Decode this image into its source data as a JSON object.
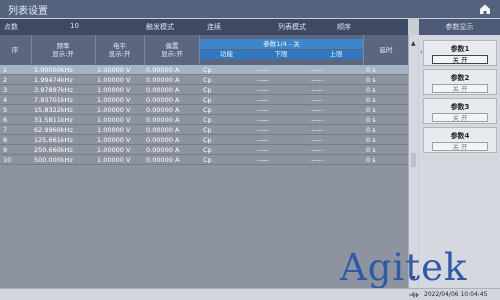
{
  "window": {
    "title": "列表设置"
  },
  "info_bar": {
    "points_label": "点数",
    "points_value": "10",
    "trigger_label": "触发模式",
    "trigger_value": "连续",
    "list_mode_label": "列表模式",
    "list_mode_value": "顺序"
  },
  "table": {
    "headers": {
      "index": "序",
      "freq_line1": "频率",
      "freq_line2": "显示:开",
      "level_line1": "电平",
      "level_line2": "显示:开",
      "bias_line1": "偏置",
      "bias_line2": "显示:开",
      "param_group": "参数1/4 - 关",
      "func": "功能",
      "lower": "下限",
      "upper": "上限",
      "delay": "延时"
    },
    "rows": [
      {
        "idx": "1",
        "freq": "1.00000kHz",
        "level": "1.00000 V",
        "bias": "0.00000 A",
        "func": "Cp",
        "lower": "-----",
        "upper": "-----",
        "delay": "0 s"
      },
      {
        "idx": "2",
        "freq": "1.99474kHz",
        "level": "1.00000 V",
        "bias": "0.00000 A",
        "func": "Cp",
        "lower": "-----",
        "upper": "-----",
        "delay": "0 s"
      },
      {
        "idx": "3",
        "freq": "3.97897kHz",
        "level": "1.00000 V",
        "bias": "0.00000 A",
        "func": "Cp",
        "lower": "-----",
        "upper": "-----",
        "delay": "0 s"
      },
      {
        "idx": "4",
        "freq": "7.93701kHz",
        "level": "1.00000 V",
        "bias": "0.00000 A",
        "func": "Cp",
        "lower": "-----",
        "upper": "-----",
        "delay": "0 s"
      },
      {
        "idx": "5",
        "freq": "15.8322kHz",
        "level": "1.00000 V",
        "bias": "0.00000 A",
        "func": "Cp",
        "lower": "-----",
        "upper": "-----",
        "delay": "0 s"
      },
      {
        "idx": "6",
        "freq": "31.5811kHz",
        "level": "1.00000 V",
        "bias": "0.00000 A",
        "func": "Cp",
        "lower": "-----",
        "upper": "-----",
        "delay": "0 s"
      },
      {
        "idx": "7",
        "freq": "62.9960kHz",
        "level": "1.00000 V",
        "bias": "0.00000 A",
        "func": "Cp",
        "lower": "-----",
        "upper": "-----",
        "delay": "0 s"
      },
      {
        "idx": "8",
        "freq": "125.661kHz",
        "level": "1.00000 V",
        "bias": "0.00000 A",
        "func": "Cp",
        "lower": "-----",
        "upper": "-----",
        "delay": "0 s"
      },
      {
        "idx": "9",
        "freq": "250.660kHz",
        "level": "1.00000 V",
        "bias": "0.00000 A",
        "func": "Cp",
        "lower": "-----",
        "upper": "-----",
        "delay": "0 s"
      },
      {
        "idx": "10",
        "freq": "500.000kHz",
        "level": "1.00000 V",
        "bias": "0.00000 A",
        "func": "Cp",
        "lower": "-----",
        "upper": "-----",
        "delay": "0 s"
      }
    ]
  },
  "side_panel": {
    "title": "参数显示",
    "buttons": [
      {
        "name": "参数1",
        "state": "关 开",
        "active": true
      },
      {
        "name": "参数2",
        "state": "关 开",
        "active": false
      },
      {
        "name": "参数3",
        "state": "关 开",
        "active": false
      },
      {
        "name": "参数4",
        "state": "关 开",
        "active": false
      }
    ]
  },
  "logo": {
    "text": "Agitek"
  },
  "status_bar": {
    "datetime": "2022/04/06 10:04:45"
  },
  "icons": {
    "home": "home-icon",
    "usb": "usb-icon",
    "scroll_up": "arrow-up-icon",
    "scroll_down": "arrow-down-icon"
  },
  "colors": {
    "title_bar": "#54627e",
    "table_bg": "#8e949f",
    "header_accent": "#3d86c9",
    "logo": "#2f5aa8"
  }
}
